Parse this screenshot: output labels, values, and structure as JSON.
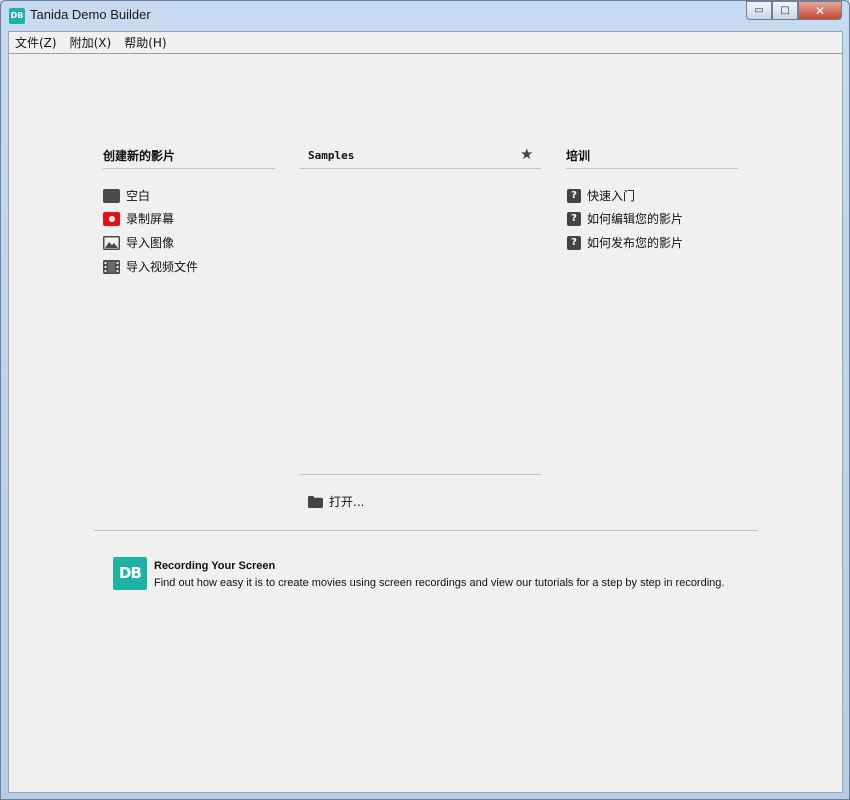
{
  "window": {
    "title": "Tanida Demo Builder",
    "icon_text": "DB",
    "controls": {
      "minimize": "▭",
      "maximize": "□",
      "close": "✕"
    }
  },
  "menu": {
    "items": [
      {
        "label": "文件(Z)"
      },
      {
        "label": "附加(X)"
      },
      {
        "label": "帮助(H)"
      }
    ]
  },
  "create": {
    "title": "创建新的影片",
    "items": [
      {
        "label": "空白",
        "icon": "blank-movie-icon"
      },
      {
        "label": "录制屏幕",
        "icon": "record-icon"
      },
      {
        "label": "导入图像",
        "icon": "image-icon"
      },
      {
        "label": "导入视频文件",
        "icon": "film-icon"
      }
    ]
  },
  "samples": {
    "title": "Samples",
    "star_icon": "★",
    "open_label": "打开..."
  },
  "training": {
    "title": "培训",
    "items": [
      {
        "label": "快速入门",
        "icon": "help-icon"
      },
      {
        "label": "如何编辑您的影片",
        "icon": "help-icon"
      },
      {
        "label": "如何发布您的影片",
        "icon": "help-icon"
      }
    ],
    "help_glyph": "?"
  },
  "tip": {
    "logo_text": "DB",
    "title": "Recording Your Screen",
    "text": "Find out how easy it is to create movies using screen recordings and view our tutorials for a step by step in recording."
  },
  "colors": {
    "brand": "#1fb3a8",
    "record": "#e3101a",
    "icon_dark": "#444444"
  }
}
